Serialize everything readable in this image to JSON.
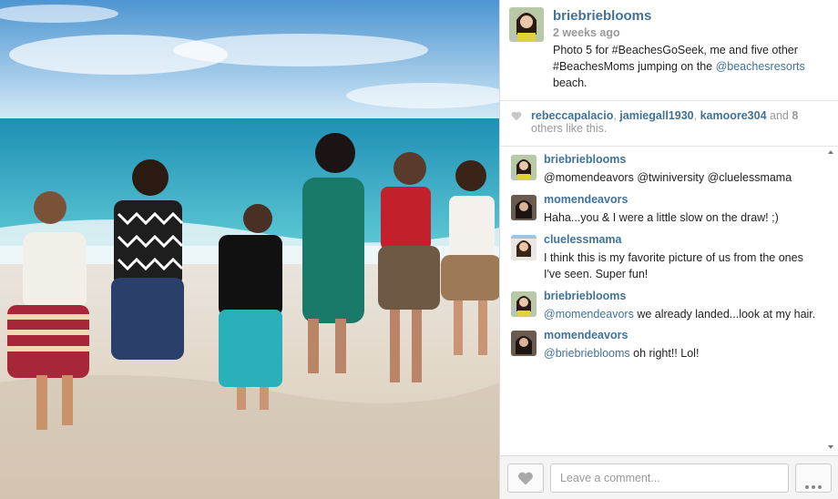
{
  "post": {
    "username": "briebrieblooms",
    "time_ago": "2 weeks ago",
    "caption_text": "Photo 5 for #BeachesGoSeek, me and five other #BeachesMoms jumping on the",
    "caption_mention": "@beachesresorts",
    "caption_end": "beach."
  },
  "likes": {
    "user1": "rebeccapalacio",
    "sep1": ", ",
    "user2": "jamiegall1930",
    "sep2": ", ",
    "user3": "kamoore304",
    "and_text": " and ",
    "others_count": "8",
    "others_text": " others like this."
  },
  "comments": [
    {
      "username": "briebrieblooms",
      "text": "@momendeavors @twiniversity @cluelessmama",
      "text_is_link": true
    },
    {
      "username": "momendeavors",
      "text": "Haha...you & I were a little slow on the draw! ;)"
    },
    {
      "username": "cluelessmama",
      "text": "I think this is my favorite picture of us from the ones I've seen. Super fun!"
    },
    {
      "username": "briebrieblooms",
      "mention": "@momendeavors",
      "text": " we already landed...look at my hair."
    },
    {
      "username": "momendeavors",
      "mention": "@briebrieblooms",
      "text": " oh right!! Lol!"
    }
  ],
  "footer": {
    "comment_placeholder": "Leave a comment..."
  },
  "icons": {
    "like": "heart-icon",
    "more": "ellipsis-icon"
  },
  "colors": {
    "link": "#3f729b",
    "muted": "#999999"
  }
}
